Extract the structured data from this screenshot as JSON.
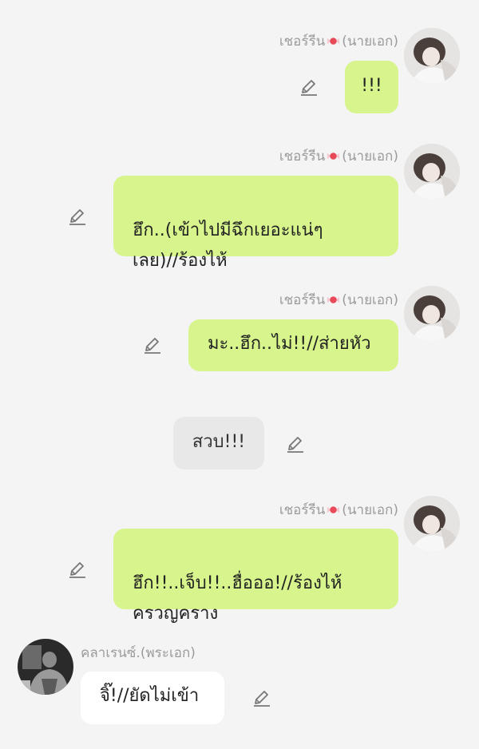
{
  "messages": [
    {
      "type": "outgoing",
      "sender": "เชอร์รีน",
      "role": "(นายเอก)",
      "text": "!!!"
    },
    {
      "type": "outgoing",
      "sender": "เชอร์รีน",
      "role": "(นายเอก)",
      "text": "ฮึก..(เข้าไปมีฉึกเยอะแน่ๆ\nเลย)//ร้องไห้"
    },
    {
      "type": "outgoing",
      "sender": "เชอร์รีน",
      "role": "(นายเอก)",
      "text": "มะ..ฮึก..ไม่!!//ส่ายหัว"
    },
    {
      "type": "narration",
      "text": "สวบ!!!"
    },
    {
      "type": "outgoing",
      "sender": "เชอร์รีน",
      "role": "(นายเอก)",
      "text": "ฮึก!!..เจ็บ!!..ฮื่อออ!//ร้องไห้\nครวญคราง"
    },
    {
      "type": "incoming",
      "sender": "คลาเรนซ์.(พระเอก)",
      "text": "จิ๊!//ยัดไม่เข้า"
    }
  ],
  "colors": {
    "background": "#f4f4f4",
    "outgoing_bubble": "#d7f58c",
    "narration_bubble": "#e8e8e8",
    "incoming_bubble": "#ffffff"
  },
  "icons": [
    "candy-icon",
    "edit-pencil-icon",
    "avatar-photo"
  ]
}
